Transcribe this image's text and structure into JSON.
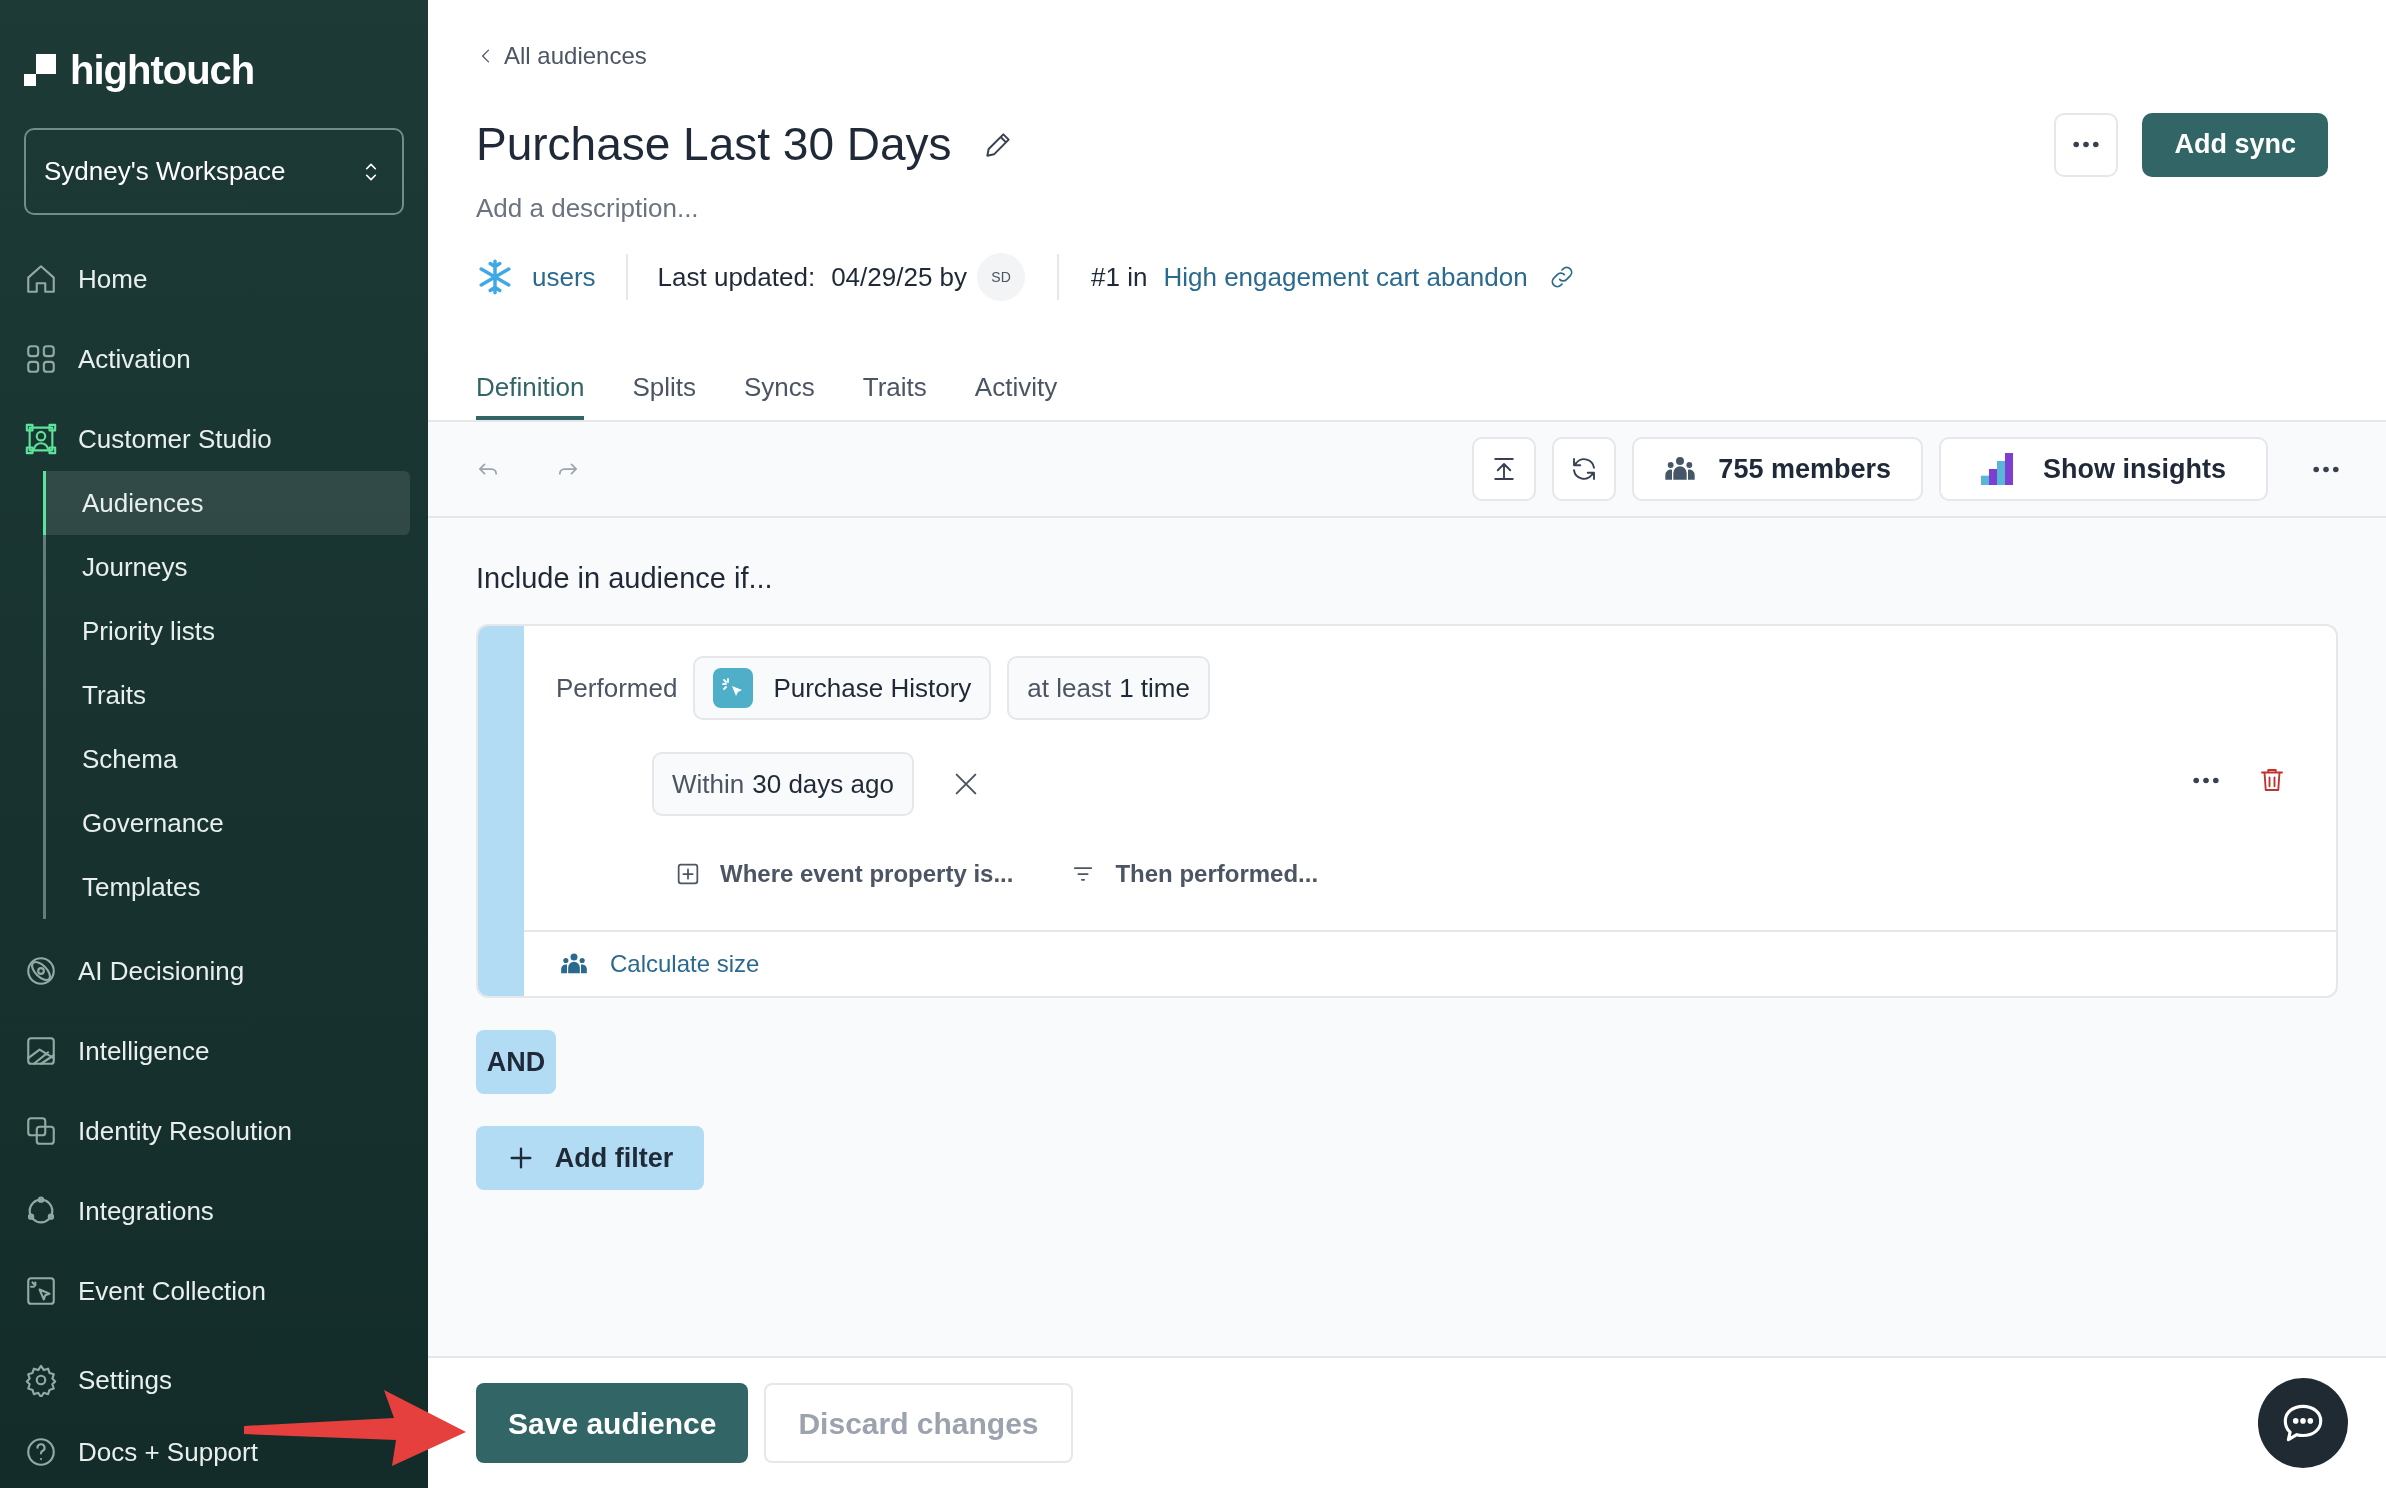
{
  "sidebar": {
    "logo": "hightouch",
    "workspace": "Sydney's Workspace",
    "items": [
      {
        "label": "Home",
        "selected": false
      },
      {
        "label": "Activation",
        "selected": false
      },
      {
        "label": "Customer Studio",
        "selected": false,
        "expanded": true,
        "children": [
          {
            "label": "Audiences",
            "selected": true
          },
          {
            "label": "Journeys",
            "selected": false
          },
          {
            "label": "Priority lists",
            "selected": false
          },
          {
            "label": "Traits",
            "selected": false
          },
          {
            "label": "Schema",
            "selected": false
          },
          {
            "label": "Governance",
            "selected": false
          },
          {
            "label": "Templates",
            "selected": false
          }
        ]
      },
      {
        "label": "AI Decisioning",
        "selected": false
      },
      {
        "label": "Intelligence",
        "selected": false
      },
      {
        "label": "Identity Resolution",
        "selected": false
      },
      {
        "label": "Integrations",
        "selected": false
      },
      {
        "label": "Event Collection",
        "selected": false
      }
    ],
    "footer_items": [
      {
        "label": "Settings",
        "selected": false
      },
      {
        "label": "Docs + Support",
        "selected": false
      }
    ]
  },
  "header": {
    "back_link": "All audiences",
    "title": "Purchase Last 30 Days",
    "description_placeholder": "Add a description...",
    "source": "users",
    "last_updated_label": "Last updated:",
    "last_updated_value": "04/29/25 by",
    "avatar": "SD",
    "priority_prefix": "#1 in",
    "priority_link": "High engagement cart abandon",
    "primary_button": "Add sync"
  },
  "tabs": [
    {
      "label": "Definition",
      "selected": true
    },
    {
      "label": "Splits",
      "selected": false
    },
    {
      "label": "Syncs",
      "selected": false
    },
    {
      "label": "Traits",
      "selected": false
    },
    {
      "label": "Activity",
      "selected": false
    }
  ],
  "toolbar": {
    "members": "755 members",
    "insights": "Show insights"
  },
  "definition": {
    "heading": "Include in audience if...",
    "condition": {
      "verb": "Performed",
      "event": "Purchase History",
      "frequency": {
        "label": "at least",
        "value": "1 time"
      },
      "window": {
        "label": "Within",
        "value": "30 days ago"
      },
      "actions": [
        "Where event property is...",
        "Then performed..."
      ],
      "calculate": "Calculate size"
    },
    "operator": "AND",
    "add_filter": "Add filter"
  },
  "footer": {
    "save": "Save audience",
    "discard": {
      "label": "Discard changes",
      "disabled": true
    }
  }
}
